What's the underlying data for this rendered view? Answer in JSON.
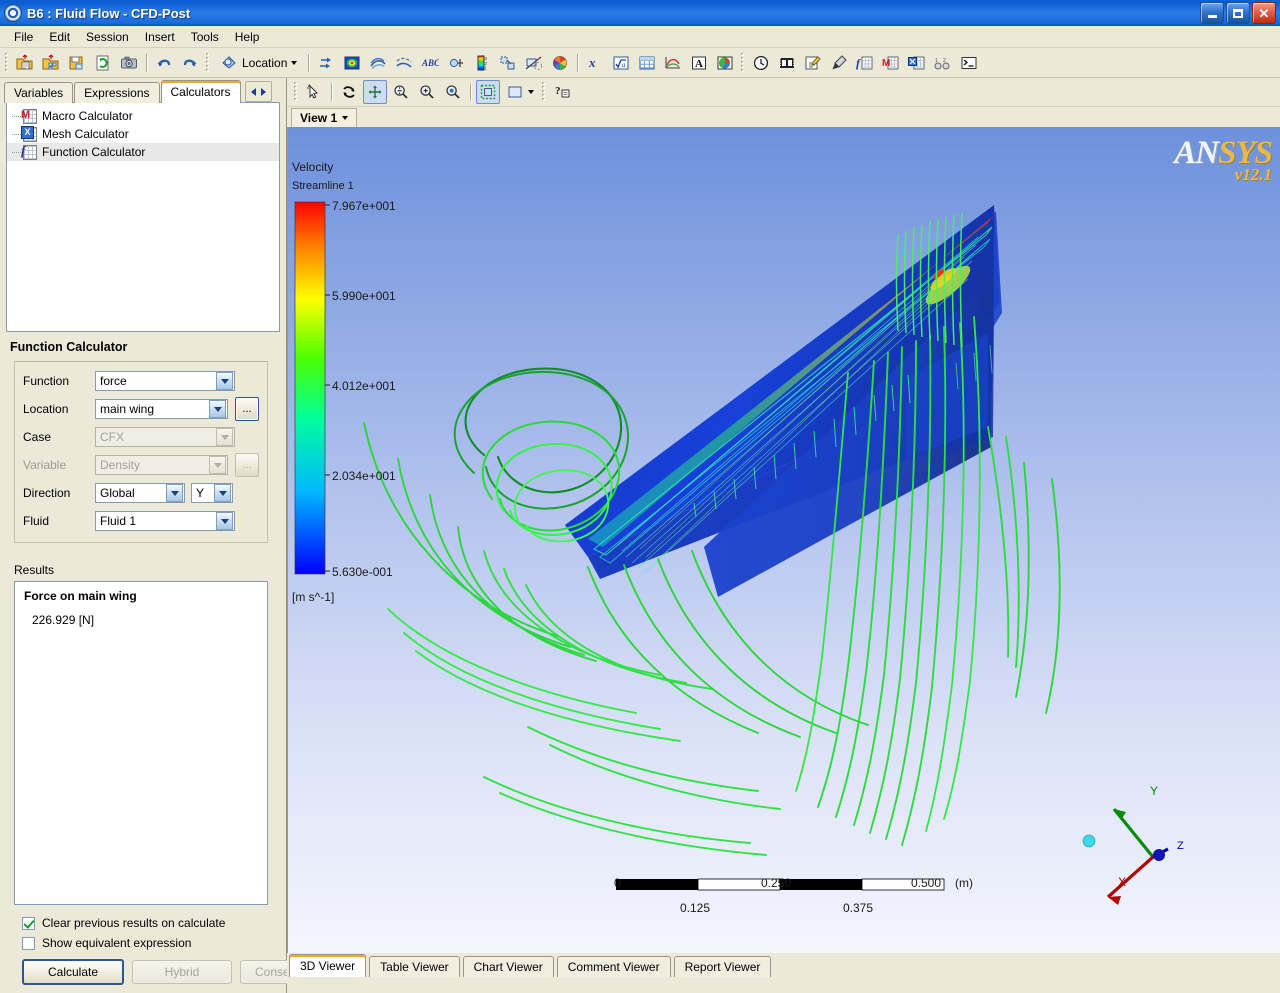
{
  "window": {
    "title": "B6 : Fluid Flow - CFD-Post",
    "icon": "eye-icon",
    "controls": {
      "minimize": "minimize-icon",
      "maximize": "maximize-icon",
      "close": "close-icon"
    }
  },
  "menu": {
    "items": [
      "File",
      "Edit",
      "Session",
      "Insert",
      "Tools",
      "Help"
    ]
  },
  "toolbar": {
    "groups": [
      {
        "buttons": [
          {
            "name": "open-file-icon"
          },
          {
            "name": "load-results-icon"
          },
          {
            "name": "save-state-icon"
          },
          {
            "name": "refresh-icon"
          },
          {
            "name": "snapshot-camera-icon"
          }
        ]
      },
      {
        "buttons": [
          {
            "name": "undo-icon"
          },
          {
            "name": "redo-icon"
          }
        ]
      },
      {
        "location_label": "Location",
        "buttons": [
          {
            "name": "vector-icon"
          },
          {
            "name": "contour-icon"
          },
          {
            "name": "streamline-icon"
          },
          {
            "name": "particle-track-icon"
          },
          {
            "name": "text-abc-icon"
          },
          {
            "name": "coordinate-frame-icon"
          },
          {
            "name": "legend-icon"
          },
          {
            "name": "instancing-transform-icon"
          },
          {
            "name": "clip-plane-icon"
          },
          {
            "name": "color-wheel-icon"
          }
        ]
      },
      {
        "buttons": [
          {
            "name": "expression-icon"
          },
          {
            "name": "variable-icon"
          },
          {
            "name": "table-icon"
          },
          {
            "name": "chart-icon"
          },
          {
            "name": "comment-icon"
          },
          {
            "name": "report-icon"
          }
        ]
      },
      {
        "buttons": [
          {
            "name": "timestep-icon"
          },
          {
            "name": "animation-icon"
          },
          {
            "name": "edit-icon"
          },
          {
            "name": "probe-icon"
          },
          {
            "name": "function-calculator-icon"
          },
          {
            "name": "macro-calculator-icon"
          },
          {
            "name": "mesh-calculator-icon"
          },
          {
            "name": "turbo-icon"
          },
          {
            "name": "command-editor-icon"
          }
        ]
      }
    ]
  },
  "sidebar": {
    "tabs": [
      {
        "label": "Variables",
        "active": false
      },
      {
        "label": "Expressions",
        "active": false
      },
      {
        "label": "Calculators",
        "active": true
      }
    ],
    "tab_nav": {
      "prev": "chevron-left-icon",
      "next": "chevron-right-icon"
    },
    "tree": [
      {
        "label": "Macro Calculator",
        "icon": "macro-calculator-icon",
        "letter": "M",
        "color": "#c0272d",
        "selected": false
      },
      {
        "label": "Mesh Calculator",
        "icon": "mesh-calculator-icon",
        "letter": "X",
        "color": "#1f4ea1",
        "selected": false
      },
      {
        "label": "Function Calculator",
        "icon": "function-calculator-icon",
        "letter": "f",
        "color": "#1f3f9e",
        "selected": true
      }
    ]
  },
  "panel": {
    "title": "Function Calculator",
    "fields": [
      {
        "label": "Function",
        "value": "force",
        "disabled": false,
        "has_ellipsis": false,
        "ellipsis_label": "..."
      },
      {
        "label": "Location",
        "value": "main wing",
        "disabled": false,
        "has_ellipsis": true,
        "ellipsis_label": "..."
      },
      {
        "label": "Case",
        "value": "CFX",
        "disabled": true,
        "has_ellipsis": false,
        "ellipsis_label": "..."
      },
      {
        "label": "Variable",
        "value": "Density",
        "disabled": true,
        "has_ellipsis": true,
        "ellipsis_label": "..."
      },
      {
        "label": "Direction",
        "value": "Global",
        "value2": "Y",
        "disabled": false,
        "has_ellipsis": false,
        "ellipsis_label": "..."
      },
      {
        "label": "Fluid",
        "value": "Fluid 1",
        "disabled": false,
        "has_ellipsis": false,
        "ellipsis_label": "..."
      }
    ],
    "results_label": "Results",
    "results": {
      "title": "Force on main wing",
      "value": "226.929 [N]"
    },
    "checkboxes": [
      {
        "label": "Clear previous results on calculate",
        "checked": true
      },
      {
        "label": "Show equivalent expression",
        "checked": false
      }
    ],
    "buttons": [
      {
        "label": "Calculate",
        "disabled": false,
        "primary": true
      },
      {
        "label": "Hybrid",
        "disabled": true,
        "primary": false
      },
      {
        "label": "Conservative",
        "disabled": true,
        "primary": false
      }
    ]
  },
  "viewer": {
    "toolbar": [
      {
        "name": "select-pick-icon",
        "pressed": false
      },
      {
        "name": "rotate-icon",
        "pressed": false
      },
      {
        "name": "pan-icon",
        "pressed": true
      },
      {
        "name": "zoom-out-icon",
        "pressed": false
      },
      {
        "name": "zoom-in-icon",
        "pressed": false
      },
      {
        "name": "zoom-box-icon",
        "pressed": false
      },
      {
        "name": "fit-view-icon",
        "pressed": true
      },
      {
        "name": "background-color-icon",
        "pressed": false
      },
      {
        "name": "whats-this-help-icon",
        "pressed": false
      }
    ],
    "view_tab": "View 1",
    "watermark": {
      "brand_left": "AN",
      "brand_right": "SYS",
      "version": "v12.1"
    },
    "legend": {
      "title": "Velocity",
      "subtitle": "Streamline 1",
      "ticks": [
        "7.967e+001",
        "5.990e+001",
        "4.012e+001",
        "2.034e+001",
        "5.630e-001"
      ],
      "units": "[m s^-1]",
      "colormap": [
        "#0000ff",
        "#00b7ff",
        "#00ff9b",
        "#4bff00",
        "#ffff00",
        "#ff8000",
        "#ff0000"
      ]
    },
    "scale_bar": {
      "top_labels": [
        "0",
        "0.250",
        "0.500"
      ],
      "unit": "(m)",
      "bottom_labels": [
        "0.125",
        "0.375"
      ]
    },
    "axis_triad": {
      "x": {
        "label": "X",
        "color": "#c00000"
      },
      "y": {
        "label": "Y",
        "color": "#008000"
      },
      "z": {
        "label": "Z",
        "color": "#0000c0"
      },
      "origin_marker": "#3fd8e8"
    }
  },
  "bottom_tabs": [
    {
      "label": "3D Viewer",
      "active": true
    },
    {
      "label": "Table Viewer",
      "active": false
    },
    {
      "label": "Chart Viewer",
      "active": false
    },
    {
      "label": "Comment Viewer",
      "active": false
    },
    {
      "label": "Report Viewer",
      "active": false
    }
  ]
}
